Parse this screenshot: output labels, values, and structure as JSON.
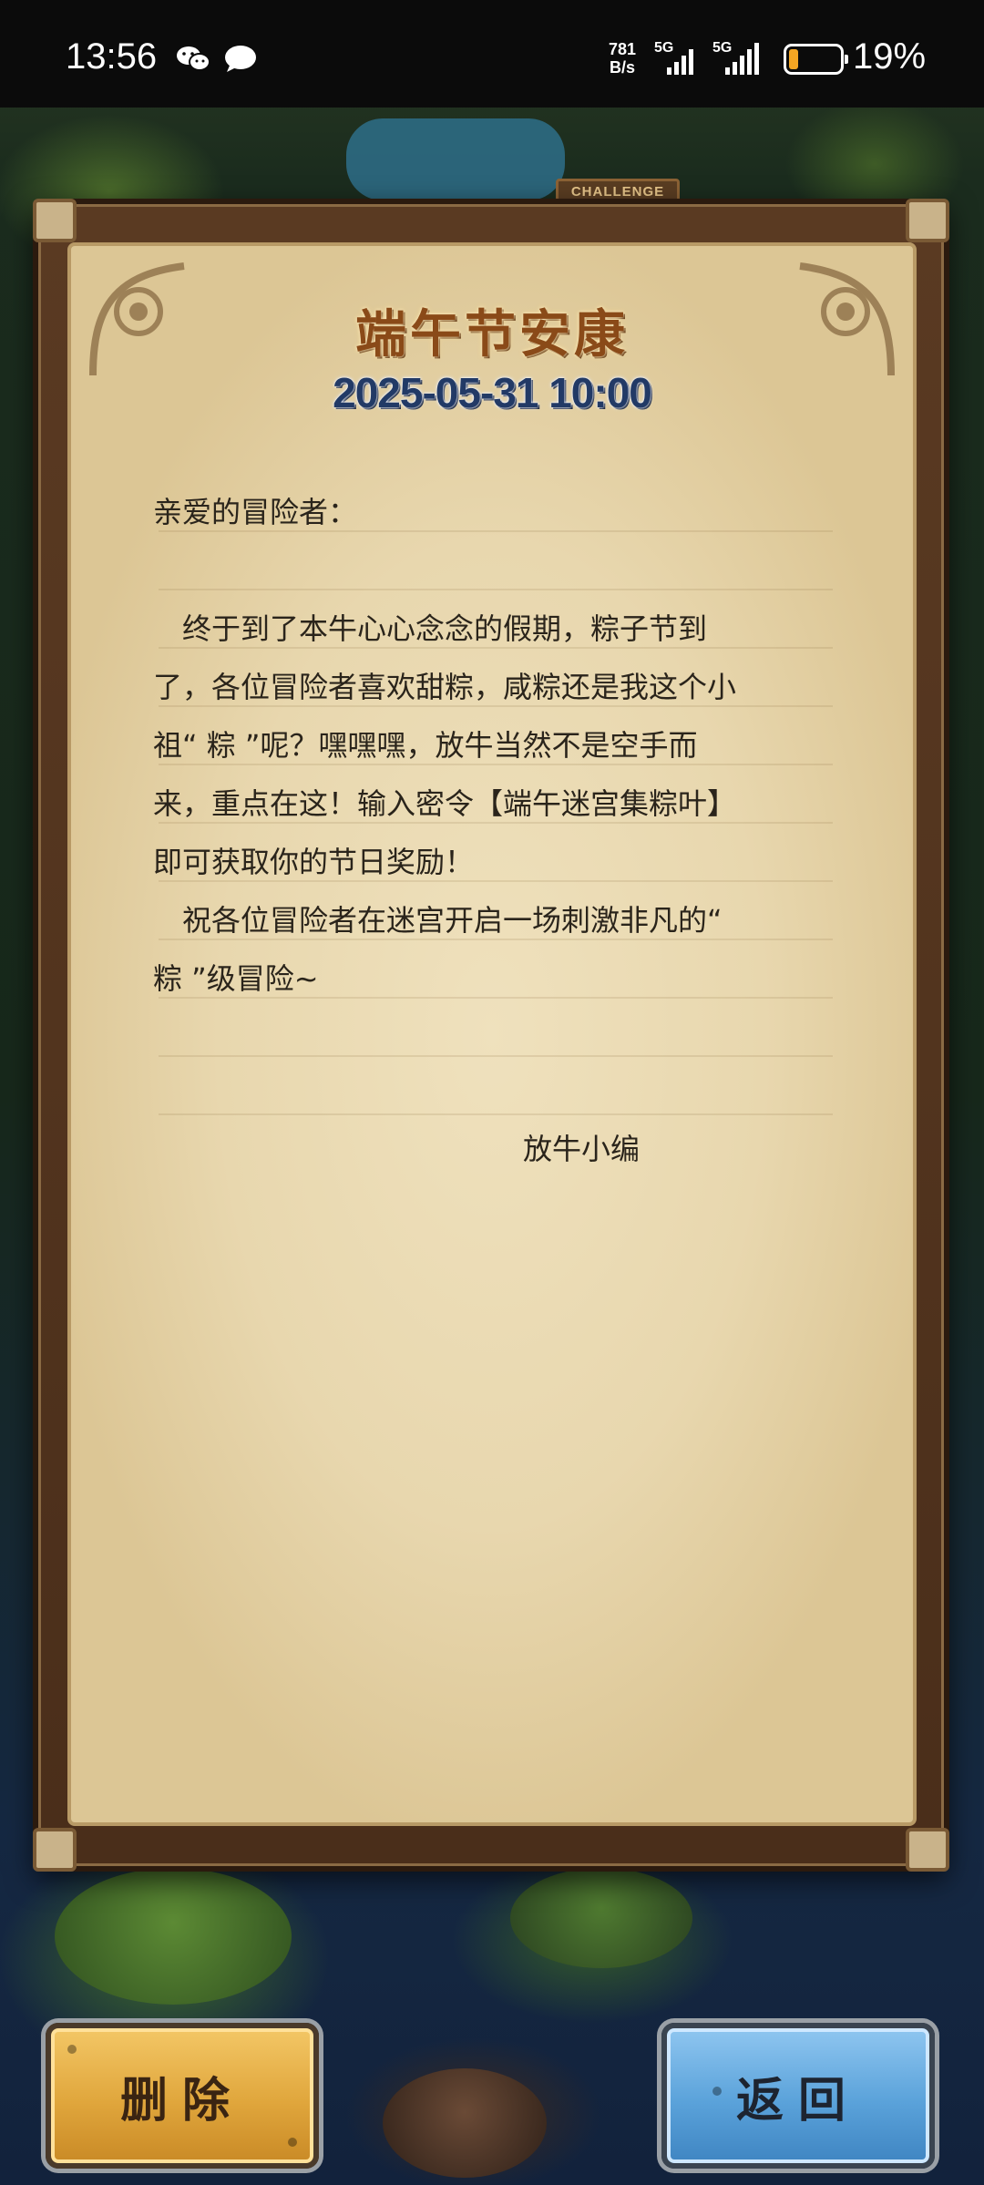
{
  "status_bar": {
    "time": "13:56",
    "notification_icons": [
      "wechat-icon",
      "chat-bubble-icon"
    ],
    "net_speed_value": "781",
    "net_speed_unit": "B/s",
    "signal_1_label": "5G",
    "signal_2_label": "5G",
    "battery_percent": "19%",
    "battery_level": 0.19,
    "battery_color": "#f5a623"
  },
  "background": {
    "sign_text": "CHALLENGE"
  },
  "letter": {
    "title": "端午节安康",
    "date": "2025-05-31 10:00",
    "greeting": "亲爱的冒险者：",
    "paragraphs": [
      "终于到了本牛心心念念的假期，粽子节到了，各位冒险者喜欢甜粽，咸粽还是我这个小祖“ 粽 ”呢？嘿嘿嘿，放牛当然不是空手而来，重点在这！输入密令【端午迷宫集粽叶】即可获取你的节日奖励！",
      "祝各位冒险者在迷宫开启一场刺激非凡的“ 粽 ”级冒险~"
    ],
    "signature": "放牛小编",
    "title_color": "#8a4a18",
    "date_color": "#223a66"
  },
  "buttons": {
    "delete_label": "删除",
    "back_label": "返回",
    "delete_color": "#e0a63c",
    "back_color": "#5aa2da"
  }
}
